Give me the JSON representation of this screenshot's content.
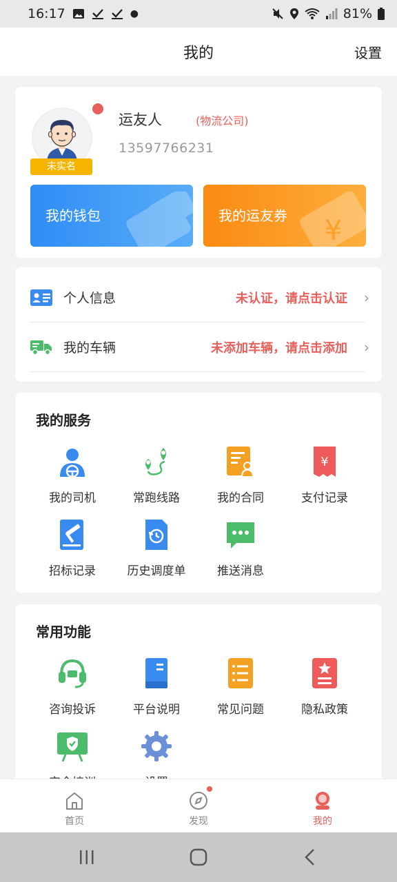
{
  "status_bar": {
    "time": "16:17",
    "battery": "81%"
  },
  "header": {
    "title": "我的",
    "settings_label": "设置"
  },
  "profile": {
    "name": "运友人",
    "company": "(物流公司)",
    "phone": "13597766231",
    "verify_badge": "未实名",
    "wallet_label": "我的钱包",
    "coupon_label": "我的运友券",
    "wallet_color": "#2e8cf5",
    "coupon_color": "#fb8a12"
  },
  "info_rows": [
    {
      "label": "个人信息",
      "status": "未认证，请点击认证",
      "icon": "id-card-icon"
    },
    {
      "label": "我的车辆",
      "status": "未添加车辆，请点击添加",
      "icon": "truck-icon"
    }
  ],
  "services": {
    "title": "我的服务",
    "items": [
      {
        "label": "我的司机",
        "icon": "driver-icon"
      },
      {
        "label": "常跑线路",
        "icon": "route-icon"
      },
      {
        "label": "我的合同",
        "icon": "contract-icon"
      },
      {
        "label": "支付记录",
        "icon": "payment-record-icon"
      },
      {
        "label": "招标记录",
        "icon": "bidding-record-icon"
      },
      {
        "label": "历史调度单",
        "icon": "dispatch-history-icon"
      },
      {
        "label": "推送消息",
        "icon": "message-icon"
      }
    ]
  },
  "common": {
    "title": "常用功能",
    "items": [
      {
        "label": "咨询投诉",
        "icon": "headset-icon"
      },
      {
        "label": "平台说明",
        "icon": "book-icon"
      },
      {
        "label": "常见问题",
        "icon": "faq-list-icon"
      },
      {
        "label": "隐私政策",
        "icon": "privacy-icon"
      },
      {
        "label": "安全培训",
        "icon": "safety-training-icon"
      },
      {
        "label": "设置",
        "icon": "gear-icon"
      }
    ]
  },
  "tabbar": {
    "tabs": [
      {
        "label": "首页",
        "icon": "home-icon"
      },
      {
        "label": "发现",
        "icon": "compass-icon"
      },
      {
        "label": "我的",
        "icon": "profile-icon"
      }
    ],
    "active_index": 2,
    "active_color": "#e8605b"
  }
}
